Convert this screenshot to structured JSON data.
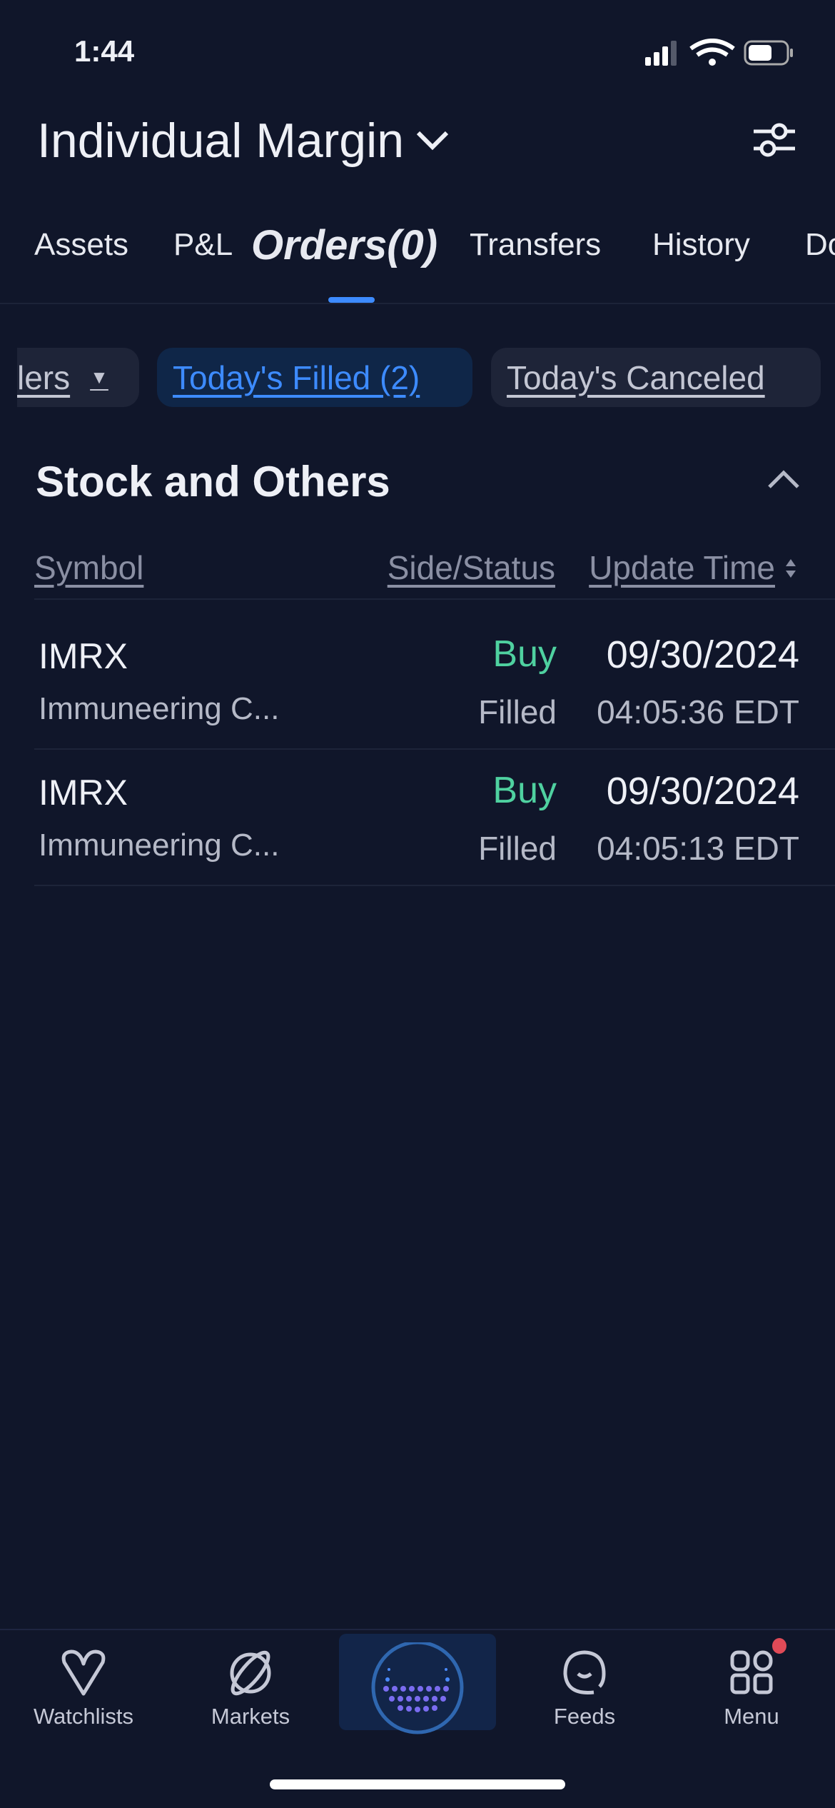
{
  "status_bar": {
    "time": "1:44"
  },
  "header": {
    "account": "Individual Margin"
  },
  "tabs": [
    {
      "label": "Assets"
    },
    {
      "label": "P&L"
    },
    {
      "label": "Orders(0)",
      "active": true
    },
    {
      "label": "Transfers"
    },
    {
      "label": "History"
    },
    {
      "label": "Do"
    }
  ],
  "filters": [
    {
      "label": "lers"
    },
    {
      "label": "Today's Filled (2)",
      "selected": true
    },
    {
      "label": "Today's Canceled"
    }
  ],
  "section": {
    "title": "Stock and Others"
  },
  "columns": {
    "symbol": "Symbol",
    "side_status": "Side/Status",
    "update_time": "Update Time"
  },
  "orders": [
    {
      "symbol": "IMRX",
      "name": "Immuneering C...",
      "side": "Buy",
      "status": "Filled",
      "date": "09/30/2024",
      "time": "04:05:36 EDT"
    },
    {
      "symbol": "IMRX",
      "name": "Immuneering C...",
      "side": "Buy",
      "status": "Filled",
      "date": "09/30/2024",
      "time": "04:05:13 EDT"
    }
  ],
  "bottom_nav": [
    {
      "label": "Watchlists",
      "icon": "heart-icon"
    },
    {
      "label": "Markets",
      "icon": "planet-icon"
    },
    {
      "label": "",
      "icon": "assistant-icon"
    },
    {
      "label": "Feeds",
      "icon": "chat-icon"
    },
    {
      "label": "Menu",
      "icon": "grid-icon",
      "badge": true
    }
  ],
  "colors": {
    "background": "#10162a",
    "accent": "#3d8bff",
    "buy": "#4fd1a0",
    "badge": "#e04a57"
  }
}
